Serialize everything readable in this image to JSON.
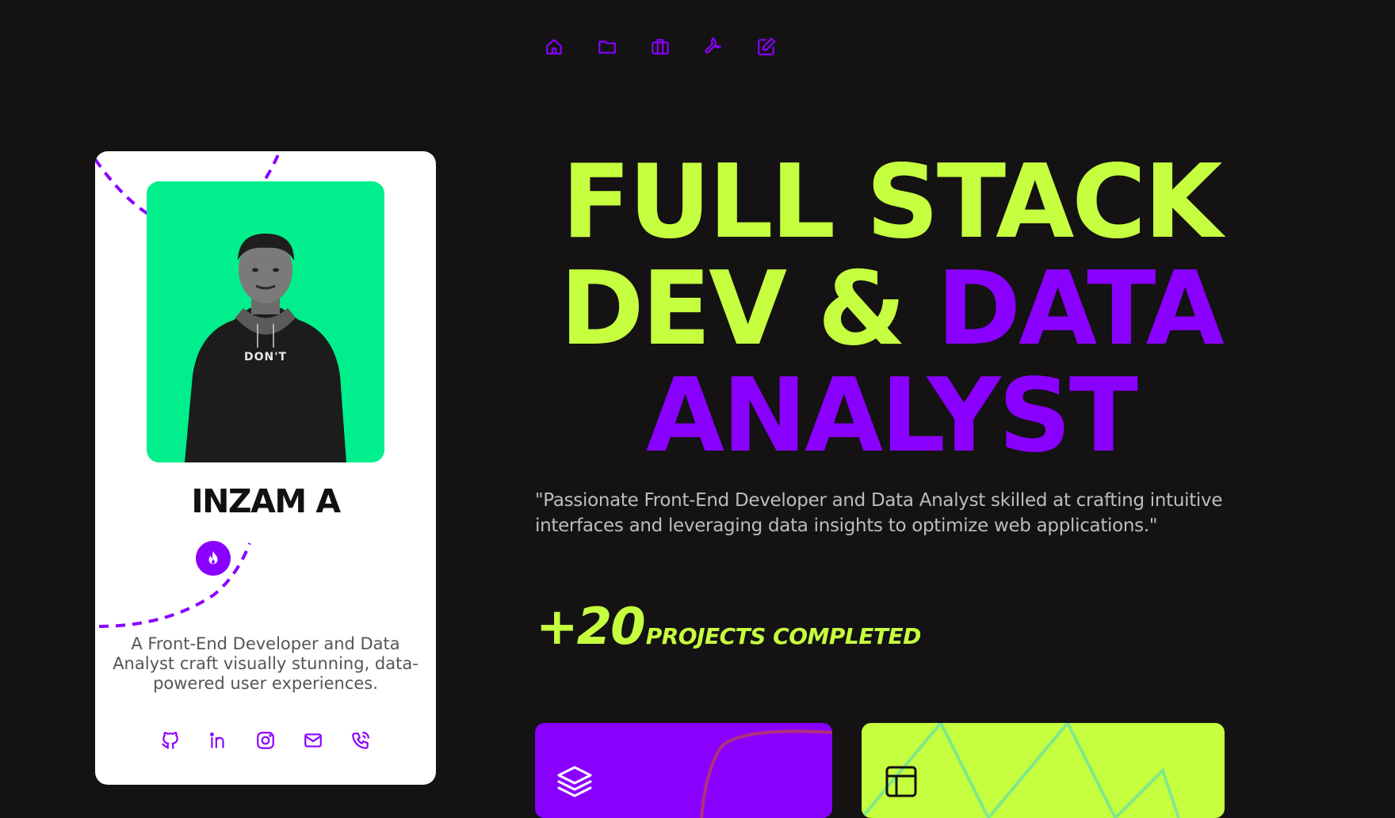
{
  "nav": {
    "items": [
      {
        "icon": "home-icon"
      },
      {
        "icon": "folder-icon"
      },
      {
        "icon": "briefcase-icon"
      },
      {
        "icon": "wrench-icon"
      },
      {
        "icon": "edit-icon"
      }
    ]
  },
  "profile": {
    "name": "INZAM A",
    "badge_icon": "fire-icon",
    "bio": "A Front-End Developer and Data Analyst craft visually stunning, data-powered user experiences.",
    "socials": [
      "github-icon",
      "linkedin-icon",
      "instagram-icon",
      "mail-icon",
      "phone-icon"
    ]
  },
  "hero": {
    "line1": "FULL STACK",
    "line2_a": "DEV & ",
    "line2_b": "DATA",
    "line3": "ANALYST",
    "tagline": "\"Passionate Front-End Developer and Data Analyst skilled at crafting intuitive interfaces and leveraging data insights to optimize web applications.\""
  },
  "stats": {
    "number": "+20",
    "label": "PROJECTS COMPLETED"
  },
  "tiles": [
    {
      "icon": "layers-icon",
      "color": "#8a00ff"
    },
    {
      "icon": "layout-icon",
      "color": "#c6ff3f"
    }
  ],
  "colors": {
    "background": "#141213",
    "accent_purple": "#8a00ff",
    "accent_lime": "#c6ff3f",
    "photo_bg": "#00ef8c"
  }
}
